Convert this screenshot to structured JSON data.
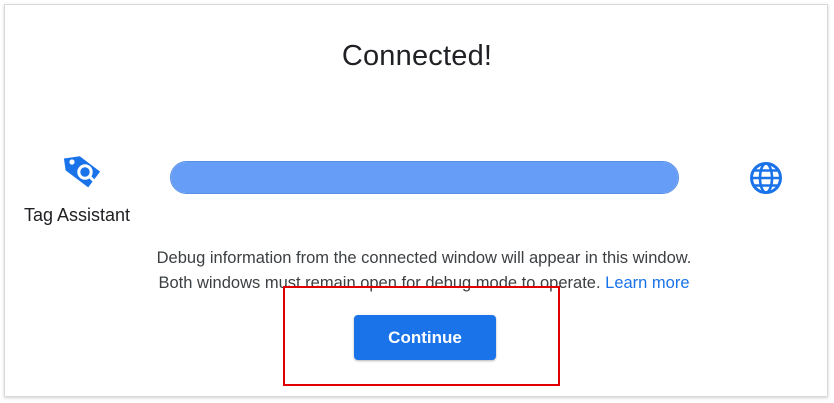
{
  "dialog": {
    "title": "Connected!"
  },
  "connection": {
    "source_label": "Tag Assistant",
    "source_icon": "tag-search-icon",
    "target_icon": "globe-icon",
    "progress": 1.0,
    "accent_color": "#1a73e8",
    "progress_color": "#669df6"
  },
  "info": {
    "line1": "Debug information from the connected window will appear in this window.",
    "line2": "Both windows must remain open for debug mode to operate.",
    "learn_more": "Learn more"
  },
  "actions": {
    "continue_label": "Continue"
  },
  "annotation": {
    "highlight_color": "#e00000"
  }
}
